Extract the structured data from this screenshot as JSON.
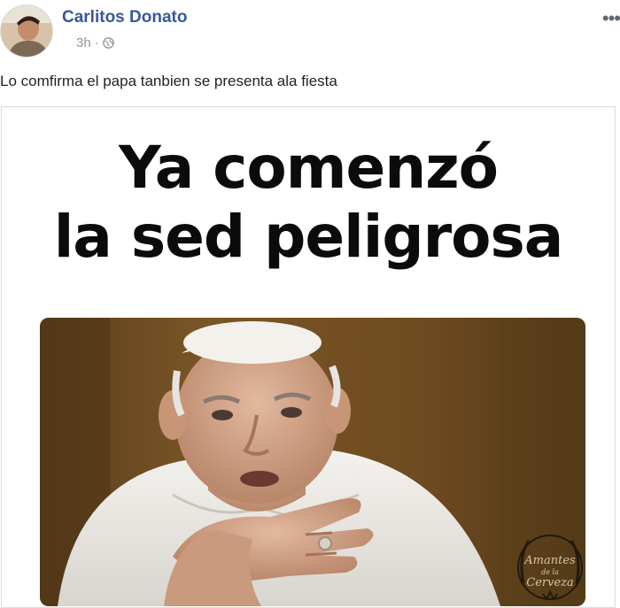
{
  "post": {
    "author": "Carlitos Donato",
    "time": "3h",
    "separator": "·",
    "privacy_icon": "globe-icon",
    "more_icon": "more-options-icon",
    "more_label": "•••",
    "caption": "Lo comfirma el papa tanbien se presenta ala fiesta"
  },
  "meme": {
    "line1": "Ya comenzó",
    "line2": "la sed peligrosa",
    "watermark_text": "Amantes de la Cerveza",
    "photo": "photo of elderly man in white robe and skullcap holding hand to throat"
  },
  "colors": {
    "author_link": "#385898",
    "meta_text": "#90949c",
    "caption_text": "#1d2129",
    "meme_text": "#0b0b0b"
  }
}
